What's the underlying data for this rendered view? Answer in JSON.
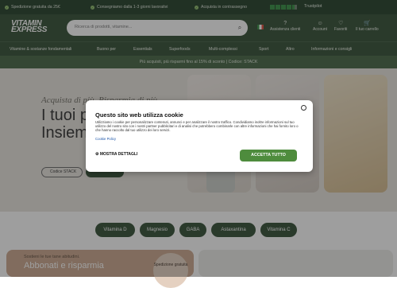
{
  "topbar": {
    "usp1": "Spedizione gratuita da 25€",
    "usp2": "Consegniamo dalla 1-3 giorni lavorativi",
    "usp3": "Acquista in contrassegno",
    "rating_label": "Trustpilot"
  },
  "header": {
    "logo_line1": "VITAMIN",
    "logo_line2": "EXPRESS",
    "search_placeholder": "Ricerca di prodotti, vitamine...",
    "service": "Assistenza clienti",
    "account": "Account",
    "favorites": "Favoriti",
    "cart": "Il tuo carrello"
  },
  "nav": {
    "items": [
      "Vitamine & sostanze fondamentali",
      "Buono per",
      "Essentials",
      "Superfoods",
      "Multi-complessi",
      "Sport",
      "Altro",
      "Informazioni e consigli"
    ]
  },
  "promo": "Più acquisti, più risparmi fino al 15% di sconto | Codice: STACK",
  "hero": {
    "sub": "Acquista di più. Risparmia di più.",
    "title_line1": "I tuoi p",
    "title_line2": "Insiem",
    "code_label": "Codice STACK"
  },
  "categories": [
    "Vitamina D",
    "Magnesio",
    "GABA",
    "Astaxantina",
    "Vitamina C"
  ],
  "subscribe": {
    "line1": "Sostieni le tue tane abitudini.",
    "line2": "Abbonati e risparmia",
    "badge": "Spedizione gratuita"
  },
  "cookie": {
    "title": "Questo sito web utilizza cookie",
    "body": "Utilizziamo i cookie per personalizzare contenuti, annunci e per analizzare il nostro traffico. Condividiamo inoltre informazioni sul tuo utilizzo del nostro sito con i nostri partner pubblicitari e di analisi che potrebbero combinarle con altre informazioni che hai fornito loro o che hanno raccolto dal tuo utilizzo dei loro servizi.",
    "policy": "Cookie Policy",
    "details": "MOSTRA DETTAGLI",
    "accept": "ACCETTA TUTTO"
  },
  "colors": {
    "brand": "#2d4a2f",
    "accept": "#4e8c3d"
  }
}
